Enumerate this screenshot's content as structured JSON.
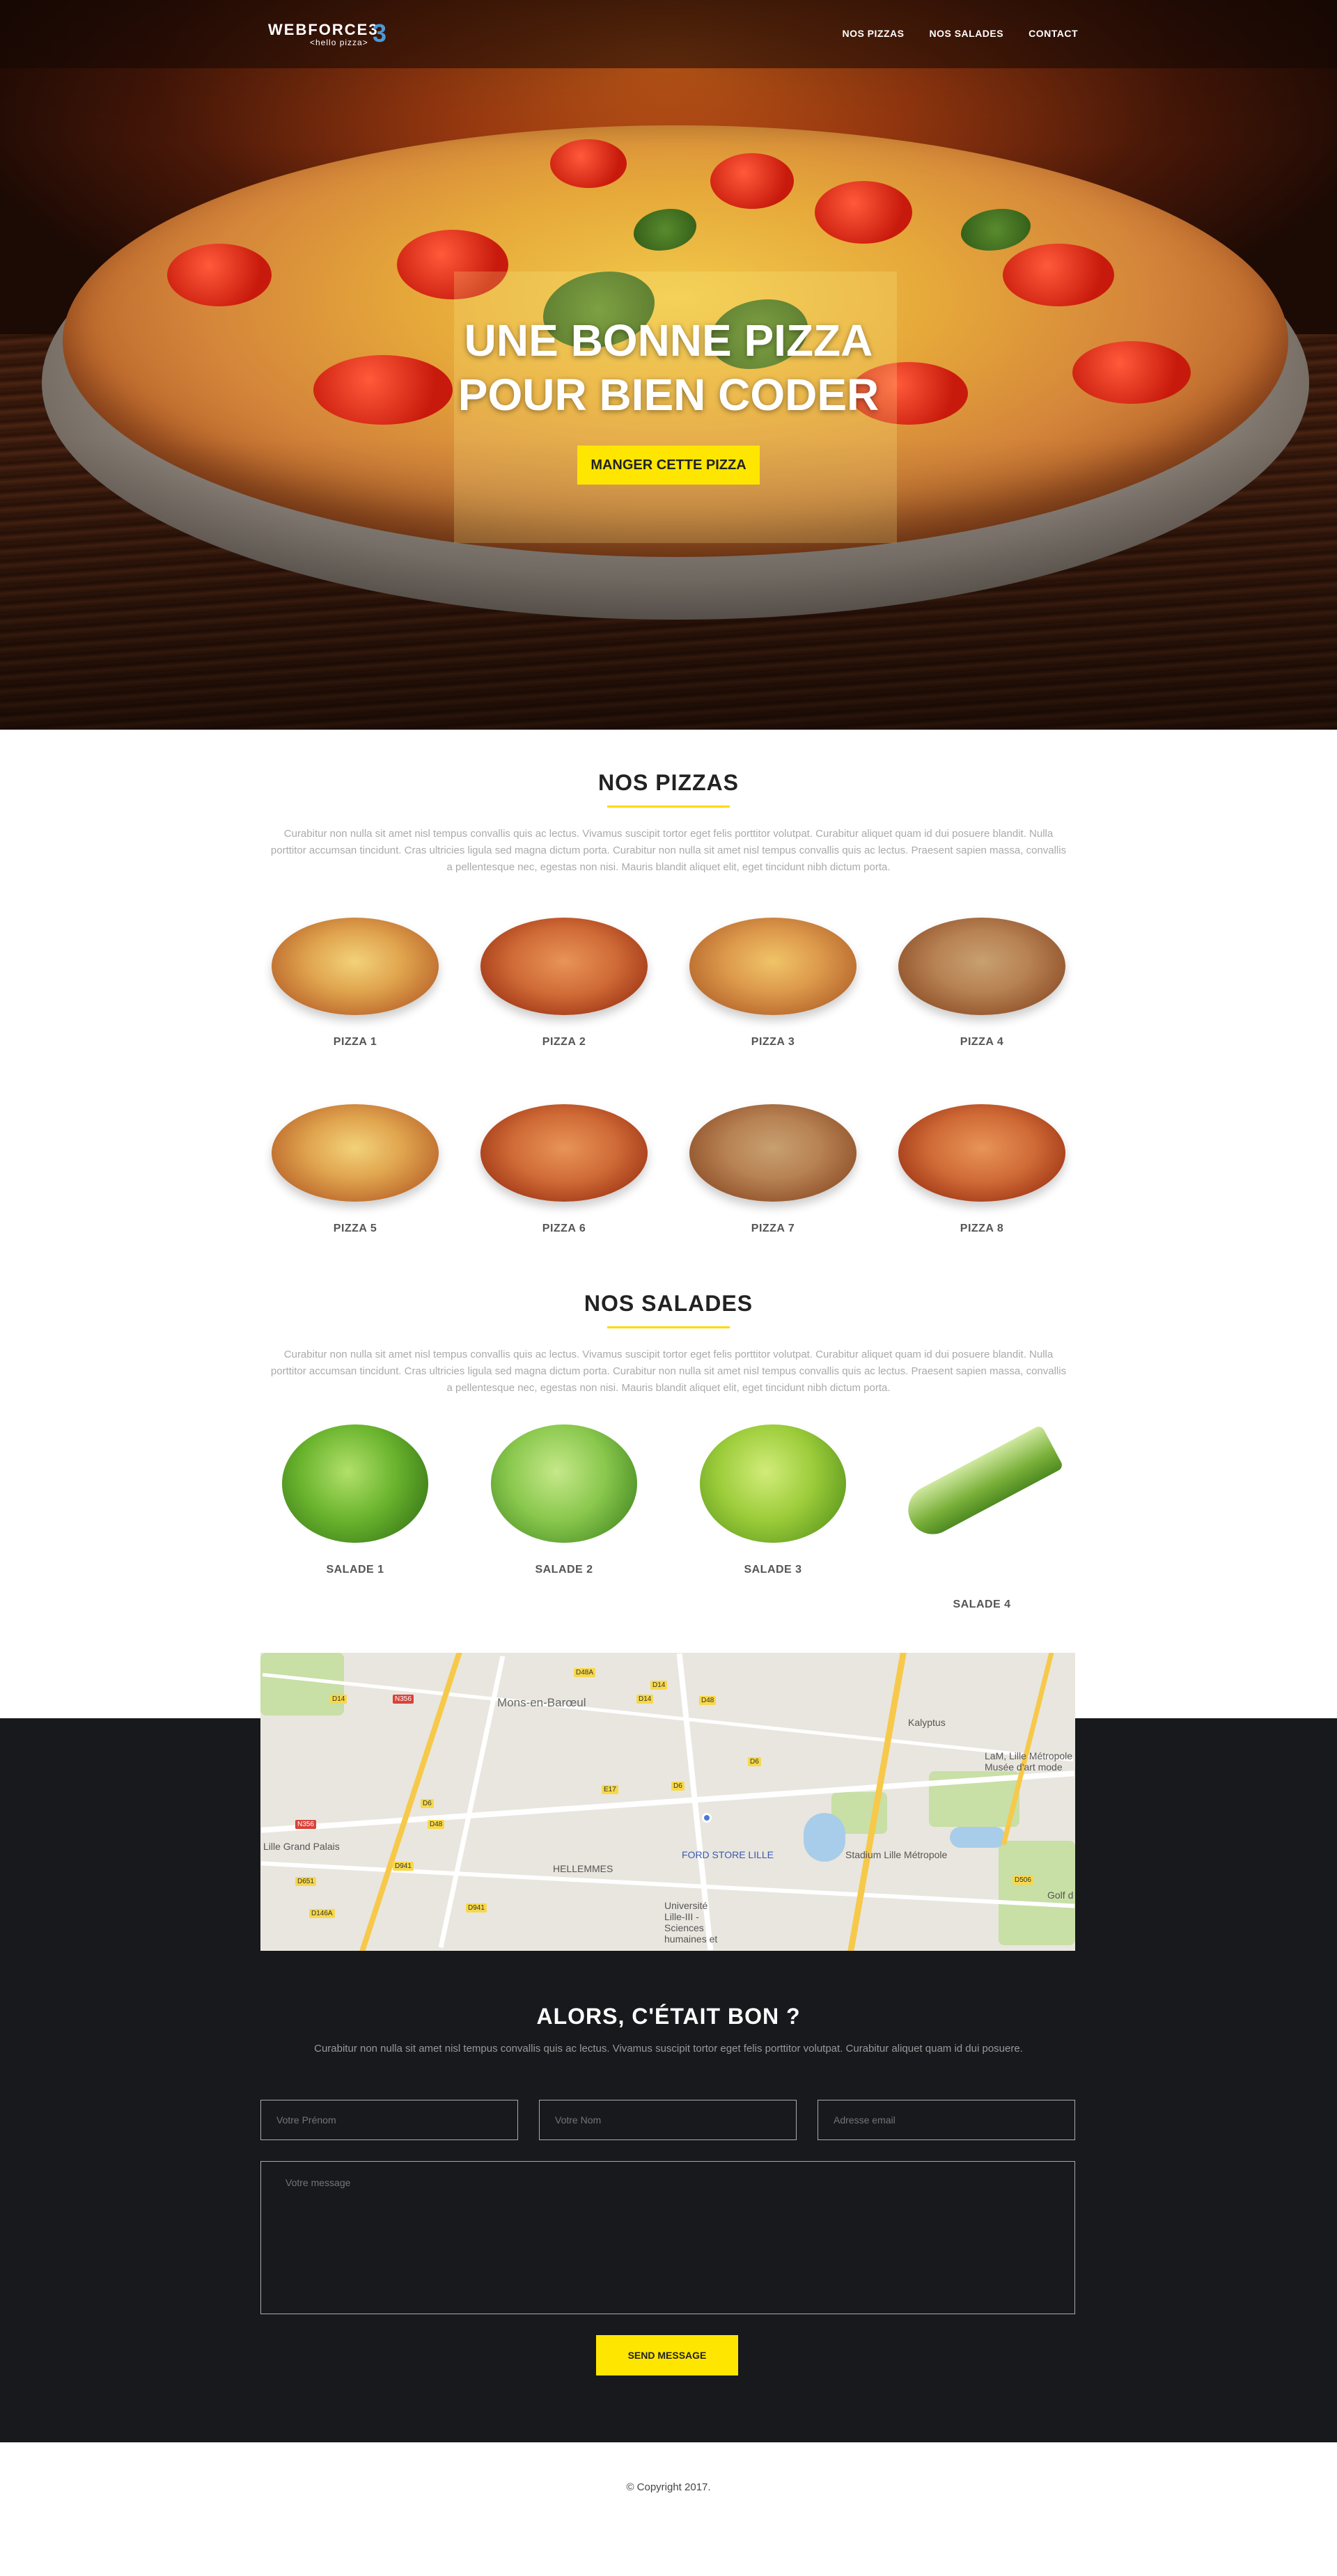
{
  "header": {
    "logo_main": "WEBFORCE3",
    "logo_sub": "<hello pizza>",
    "nav": [
      "NOS PIZZAS",
      "NOS SALADES",
      "CONTACT"
    ]
  },
  "hero": {
    "title_line1": "UNE BONNE PIZZA",
    "title_line2": "POUR BIEN CODER",
    "cta": "MANGER CETTE PIZZA"
  },
  "pizzas": {
    "title": "NOS PIZZAS",
    "text": "Curabitur non nulla sit amet nisl tempus convallis quis ac lectus. Vivamus suscipit tortor eget felis porttitor volutpat. Curabitur aliquet quam id dui posuere blandit. Nulla porttitor accumsan tincidunt. Cras ultricies ligula sed magna dictum porta. Curabitur non nulla sit amet nisl tempus convallis quis ac lectus. Praesent sapien massa, convallis a pellentesque nec, egestas non nisi. Mauris blandit aliquet elit, eget tincidunt nibh dictum porta.",
    "items": [
      "PIZZA 1",
      "PIZZA 2",
      "PIZZA 3",
      "PIZZA 4",
      "PIZZA 5",
      "PIZZA 6",
      "PIZZA 7",
      "PIZZA 8"
    ]
  },
  "salads": {
    "title": "NOS SALADES",
    "text": "Curabitur non nulla sit amet nisl tempus convallis quis ac lectus. Vivamus suscipit tortor eget felis porttitor volutpat. Curabitur aliquet quam id dui posuere blandit. Nulla porttitor accumsan tincidunt. Cras ultricies ligula sed magna dictum porta. Curabitur non nulla sit amet nisl tempus convallis quis ac lectus. Praesent sapien massa, convallis a pellentesque nec, egestas non nisi. Mauris blandit aliquet elit, eget tincidunt nibh dictum porta.",
    "items": [
      "SALADE 1",
      "SALADE 2",
      "SALADE 3",
      "SALADE 4"
    ]
  },
  "map": {
    "labels": [
      "Mons-en-Barœul",
      "Kalyptus",
      "LaM, Lille Métropole Musée d'art mode",
      "Lille Grand Palais",
      "HELLEMMES",
      "FORD STORE LILLE",
      "Stadium Lille Métropole",
      "Université Lille-III - Sciences humaines et",
      "Golf d"
    ],
    "road_tags": [
      "D48A",
      "D14",
      "N356",
      "D14",
      "D48",
      "D6",
      "D6",
      "D48",
      "E17",
      "D506",
      "D941",
      "D146A",
      "D941",
      "D651",
      "N356",
      "D6",
      "D14"
    ]
  },
  "contact": {
    "title": "ALORS, C'ÉTAIT BON ?",
    "subtitle": "Curabitur non nulla sit amet nisl tempus convallis quis ac lectus. Vivamus suscipit tortor eget felis porttitor volutpat. Curabitur aliquet quam id dui posuere.",
    "firstname_placeholder": "Votre Prénom",
    "lastname_placeholder": "Votre Nom",
    "email_placeholder": "Adresse email",
    "message_placeholder": "Votre message",
    "send": "SEND MESSAGE"
  },
  "footer": {
    "copyright": "© Copyright 2017."
  },
  "colors": {
    "accent": "#ffe600",
    "dark_bg": "#17191c"
  }
}
